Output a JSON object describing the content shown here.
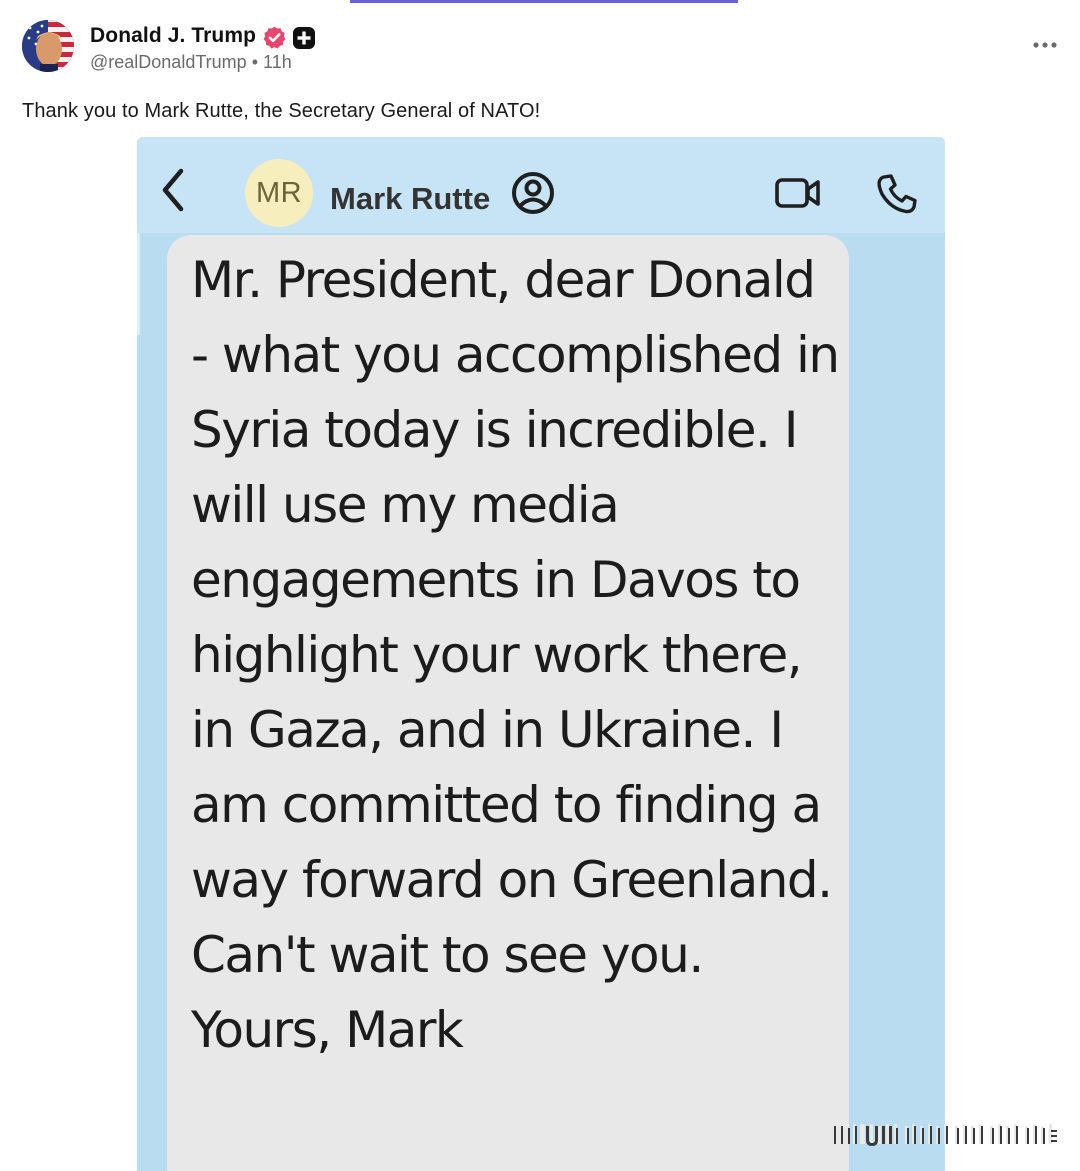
{
  "post": {
    "author_name": "Donald J. Trump",
    "handle": "@realDonaldTrump",
    "separator": "•",
    "time": "11h",
    "text": "Thank you to Mark Rutte, the Secretary General of NATO!",
    "icons": {
      "verified": "verified-badge-icon",
      "plus": "plus-badge-icon",
      "more": "more-options-icon"
    },
    "colors": {
      "verified": "#e5476f",
      "accent_bar": "#6d5fd6"
    }
  },
  "screenshot": {
    "contact_initials": "MR",
    "contact_name": "Mark Rutte",
    "icons": {
      "back": "chevron-left-icon",
      "contact_info": "contact-info-icon",
      "video": "video-call-icon",
      "phone": "phone-icon"
    },
    "message": "Mr. President, dear Donald - what you accomplished in Syria today is incredible. I will use my media engagements in Davos to highlight your work there, in Gaza, and in Ukraine. I am committed to finding a way forward on Greenland. Can't wait to see you. Yours, Mark",
    "colors": {
      "background": "#b9dcf1",
      "bubble": "#e8e8e8",
      "contact_avatar": "#f7eebd"
    }
  }
}
